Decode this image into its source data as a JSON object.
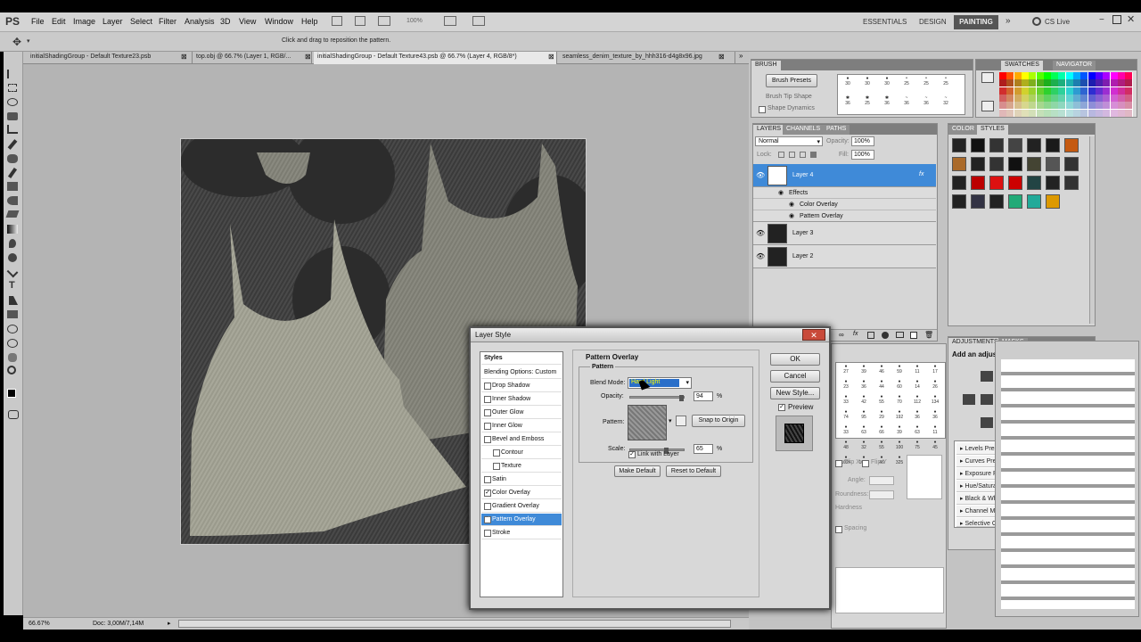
{
  "app": {
    "logo": "PS"
  },
  "menu": [
    "File",
    "Edit",
    "Image",
    "Layer",
    "Select",
    "Filter",
    "Analysis",
    "3D",
    "View",
    "Window",
    "Help"
  ],
  "zoom_menu": "100%",
  "workspaces": {
    "essentials": "ESSENTIALS",
    "design": "DESIGN",
    "painting": "PAINTING",
    "cslive": "CS Live"
  },
  "options_hint": "Click and drag to reposition the pattern.",
  "tabs": [
    "initialShadingGroup - Default Texture23.psb",
    "top.obj @ 66.7% (Layer 1, RGB/...",
    "initialShadingGroup - Default Texture43.psb @ 66.7% (Layer 4, RGB/8*)",
    "seamless_denim_texture_by_hhh316-d4g8x96.jpg"
  ],
  "status": {
    "zoom": "66.67%",
    "doc": "Doc: 3,00M/7,14M"
  },
  "brush_panel": {
    "tab": "BRUSH",
    "presets_btn": "Brush Presets",
    "tip_shape": "Brush Tip Shape",
    "shape_dynamics": "Shape Dynamics",
    "sizes": [
      "30",
      "30",
      "30",
      "25",
      "25",
      "25",
      "36",
      "25",
      "36",
      "36",
      "36",
      "32"
    ]
  },
  "swatches_panel": {
    "tab1": "SWATCHES",
    "tab2": "NAVIGATOR"
  },
  "layers_panel": {
    "tabs": [
      "LAYERS",
      "CHANNELS",
      "PATHS"
    ],
    "mode": "Normal",
    "opacity_label": "Opacity:",
    "opacity": "100%",
    "lock_label": "Lock:",
    "fill_label": "Fill:",
    "fill": "100%",
    "layers": [
      "Layer 4",
      "Layer 3",
      "Layer 2"
    ],
    "effects_label": "Effects",
    "effects": [
      "Color Overlay",
      "Pattern Overlay"
    ],
    "fx": "fx"
  },
  "styles_panel": {
    "tab1": "COLOR",
    "tab2": "STYLES"
  },
  "adjustments_panel": {
    "tab1": "ADJUSTMENTS",
    "tab2": "MASKS",
    "title": "Add an adjustment",
    "presets": [
      "Levels Presets",
      "Curves Presets",
      "Exposure Presets",
      "Hue/Saturation Presets",
      "Black & White Presets",
      "Channel Mixer Presets",
      "Selective Color Presets"
    ]
  },
  "brush_grid2": [
    "27",
    "39",
    "46",
    "59",
    "11",
    "17",
    "23",
    "36",
    "44",
    "60",
    "14",
    "26",
    "33",
    "42",
    "55",
    "70",
    "112",
    "134",
    "74",
    "95",
    "29",
    "192",
    "36",
    "36",
    "33",
    "63",
    "66",
    "39",
    "63",
    "11",
    "48",
    "32",
    "55",
    "100",
    "75",
    "45",
    "1024",
    "1024",
    "46",
    "325"
  ],
  "brush_opts": {
    "angle": "Angle:",
    "roundness": "Roundness:",
    "hardness": "Hardness",
    "spacing": "Spacing",
    "flipx": "Flip X",
    "flipy": "Flip Y"
  },
  "dialog": {
    "title": "Layer Style",
    "styles_list": [
      "Styles",
      "Blending Options: Custom",
      "Drop Shadow",
      "Inner Shadow",
      "Outer Glow",
      "Inner Glow",
      "Bevel and Emboss",
      "Contour",
      "Texture",
      "Satin",
      "Color Overlay",
      "Gradient Overlay",
      "Pattern Overlay",
      "Stroke"
    ],
    "section": "Pattern Overlay",
    "group": "Pattern",
    "blend_label": "Blend Mode:",
    "blend_value": "Hard Light",
    "opacity_label": "Opacity:",
    "opacity_value": "94",
    "pct": "%",
    "pattern_label": "Pattern:",
    "snap_btn": "Snap to Origin",
    "scale_label": "Scale:",
    "scale_value": "65",
    "link_label": "Link with Layer",
    "make_default": "Make Default",
    "reset_default": "Reset to Default",
    "ok": "OK",
    "cancel": "Cancel",
    "new_style": "New Style...",
    "preview": "Preview",
    "opacity_fraction": 0.94,
    "scale_fraction": 0.65
  }
}
